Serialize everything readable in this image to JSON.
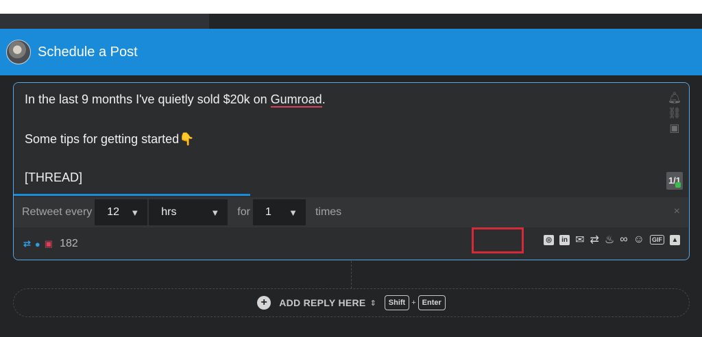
{
  "header": {
    "title": "Schedule a Post"
  },
  "editor": {
    "line1_before": "In the last 9 months I've quietly sold $20k on ",
    "line1_link": "Gumroad",
    "line1_after": ".",
    "line2": "Some tips for getting started",
    "line2_emoji": "👇",
    "line3": "[THREAD]",
    "thread_counter": "1/1"
  },
  "retweet": {
    "label": "Retweet every",
    "interval_value": "12",
    "unit_value": "hrs",
    "for_label": "for",
    "times_value": "1",
    "times_label": "times",
    "close": "×"
  },
  "stats": {
    "count": "182"
  },
  "reply": {
    "label": "ADD REPLY HERE",
    "key_shift": "Shift",
    "key_enter": "Enter",
    "plus": "+"
  }
}
